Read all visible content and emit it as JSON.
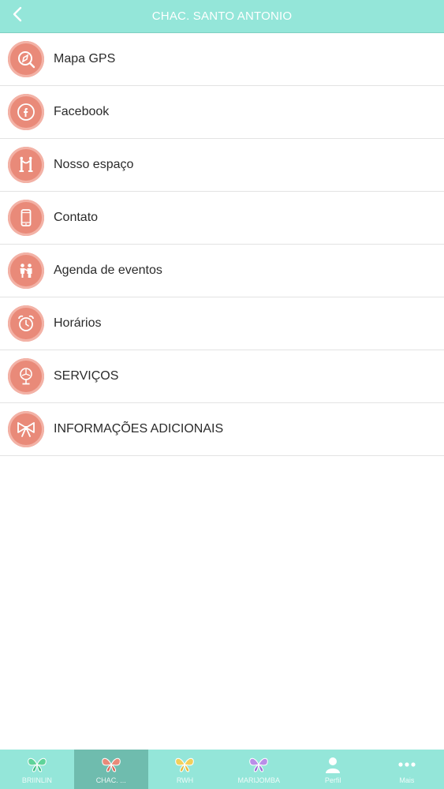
{
  "header": {
    "title": "CHAC. SANTO ANTONIO",
    "back_icon": "chevron-left-icon"
  },
  "colors": {
    "header_bg": "#94e6d9",
    "accent_icon_bg": "#e98a79",
    "tab_active_bg": "#6fbcae"
  },
  "menu": {
    "items": [
      {
        "label": "Mapa GPS",
        "icon": "compass-icon"
      },
      {
        "label": "Facebook",
        "icon": "facebook-icon"
      },
      {
        "label": "Nosso espaço",
        "icon": "stanchion-icon"
      },
      {
        "label": "Contato",
        "icon": "phone-icon"
      },
      {
        "label": "Agenda de eventos",
        "icon": "people-icon"
      },
      {
        "label": "Horários",
        "icon": "alarm-clock-icon"
      },
      {
        "label": "SERVIÇOS",
        "icon": "fan-icon"
      },
      {
        "label": "INFORMAÇÕES ADICIONAIS",
        "icon": "bow-icon"
      }
    ]
  },
  "tabbar": {
    "tabs": [
      {
        "label": "BRIINLIN",
        "icon": "butterfly-green-icon",
        "active": false
      },
      {
        "label": "CHAC. ...",
        "icon": "butterfly-red-icon",
        "active": true
      },
      {
        "label": "RWH",
        "icon": "butterfly-yellow-icon",
        "active": false
      },
      {
        "label": "MARIJOMBA",
        "icon": "butterfly-purple-icon",
        "active": false
      },
      {
        "label": "Perfil",
        "icon": "user-icon",
        "active": false
      },
      {
        "label": "Mais",
        "icon": "more-dots-icon",
        "active": false
      }
    ]
  }
}
